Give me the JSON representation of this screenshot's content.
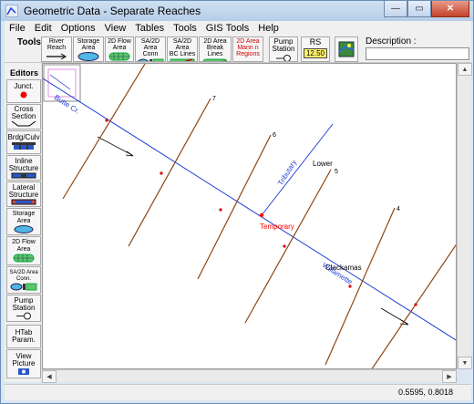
{
  "window": {
    "title": "Geometric Data - Separate Reaches",
    "buttons": {
      "minimize": "—",
      "maximize": "▭",
      "close": "✕"
    }
  },
  "menu": [
    "File",
    "Edit",
    "Options",
    "View",
    "Tables",
    "Tools",
    "GIS Tools",
    "Help"
  ],
  "toolbar": {
    "tools_label": "Tools",
    "tools": [
      {
        "label": "River\nReach",
        "icon": "river-reach-icon"
      },
      {
        "label": "Storage\nArea",
        "icon": "storage-area-icon"
      },
      {
        "label": "2D Flow\nArea",
        "icon": "2d-flow-area-icon"
      },
      {
        "label": "SA/2D Area\nConn",
        "icon": "sa-2d-connection-icon"
      },
      {
        "label": "SA/2D Area\nBC Lines",
        "icon": "bc-lines-icon"
      },
      {
        "label": "2D Area\nBreak Lines",
        "icon": "break-lines-icon"
      },
      {
        "label": "2D Area\nMann n\nRegions",
        "icon": "mannings-regions-icon"
      },
      {
        "label": "Pump\nStation",
        "icon": "pump-station-icon"
      },
      {
        "label": "RS",
        "icon": "rs-icon",
        "badge": "12.50"
      },
      {
        "label": "",
        "icon": "background-map-icon"
      }
    ],
    "description_label": "Description :",
    "description_value": ""
  },
  "editors": {
    "label": "Editors",
    "buttons": [
      {
        "label": "Junct.",
        "icon": "junction-icon"
      },
      {
        "label": "Cross\nSection",
        "icon": "cross-section-icon"
      },
      {
        "label": "Brdg/Culv",
        "icon": "bridge-culvert-icon"
      },
      {
        "label": "Inline\nStructure",
        "icon": "inline-structure-icon"
      },
      {
        "label": "Lateral\nStructure",
        "icon": "lateral-structure-icon"
      },
      {
        "label": "Storage\nArea",
        "icon": "storage-area-icon"
      },
      {
        "label": "2D Flow\nArea",
        "icon": "2d-flow-area-icon"
      },
      {
        "label": "SA/2D Area\nConn.",
        "icon": "sa-2d-connection-icon"
      },
      {
        "label": "Pump\nStation",
        "icon": "pump-station-icon"
      },
      {
        "label": "HTab\nParam.",
        "icon": "htab-param-icon"
      },
      {
        "label": "View\nPicture",
        "icon": "view-picture-icon"
      }
    ]
  },
  "canvas": {
    "river_labels": [
      "Butte Cr.",
      "Tributary",
      "Willamette"
    ],
    "reach_labels": [
      "Lower",
      "Clackamas"
    ],
    "junction_label": "Temporary",
    "cross_section_labels": [
      "7",
      "6",
      "5",
      "4"
    ],
    "colors": {
      "river": "#1f3fd6",
      "cross_section": "#8b4513",
      "junction": "#ff0000"
    }
  },
  "status": {
    "coords": "0.5595, 0.8018"
  }
}
